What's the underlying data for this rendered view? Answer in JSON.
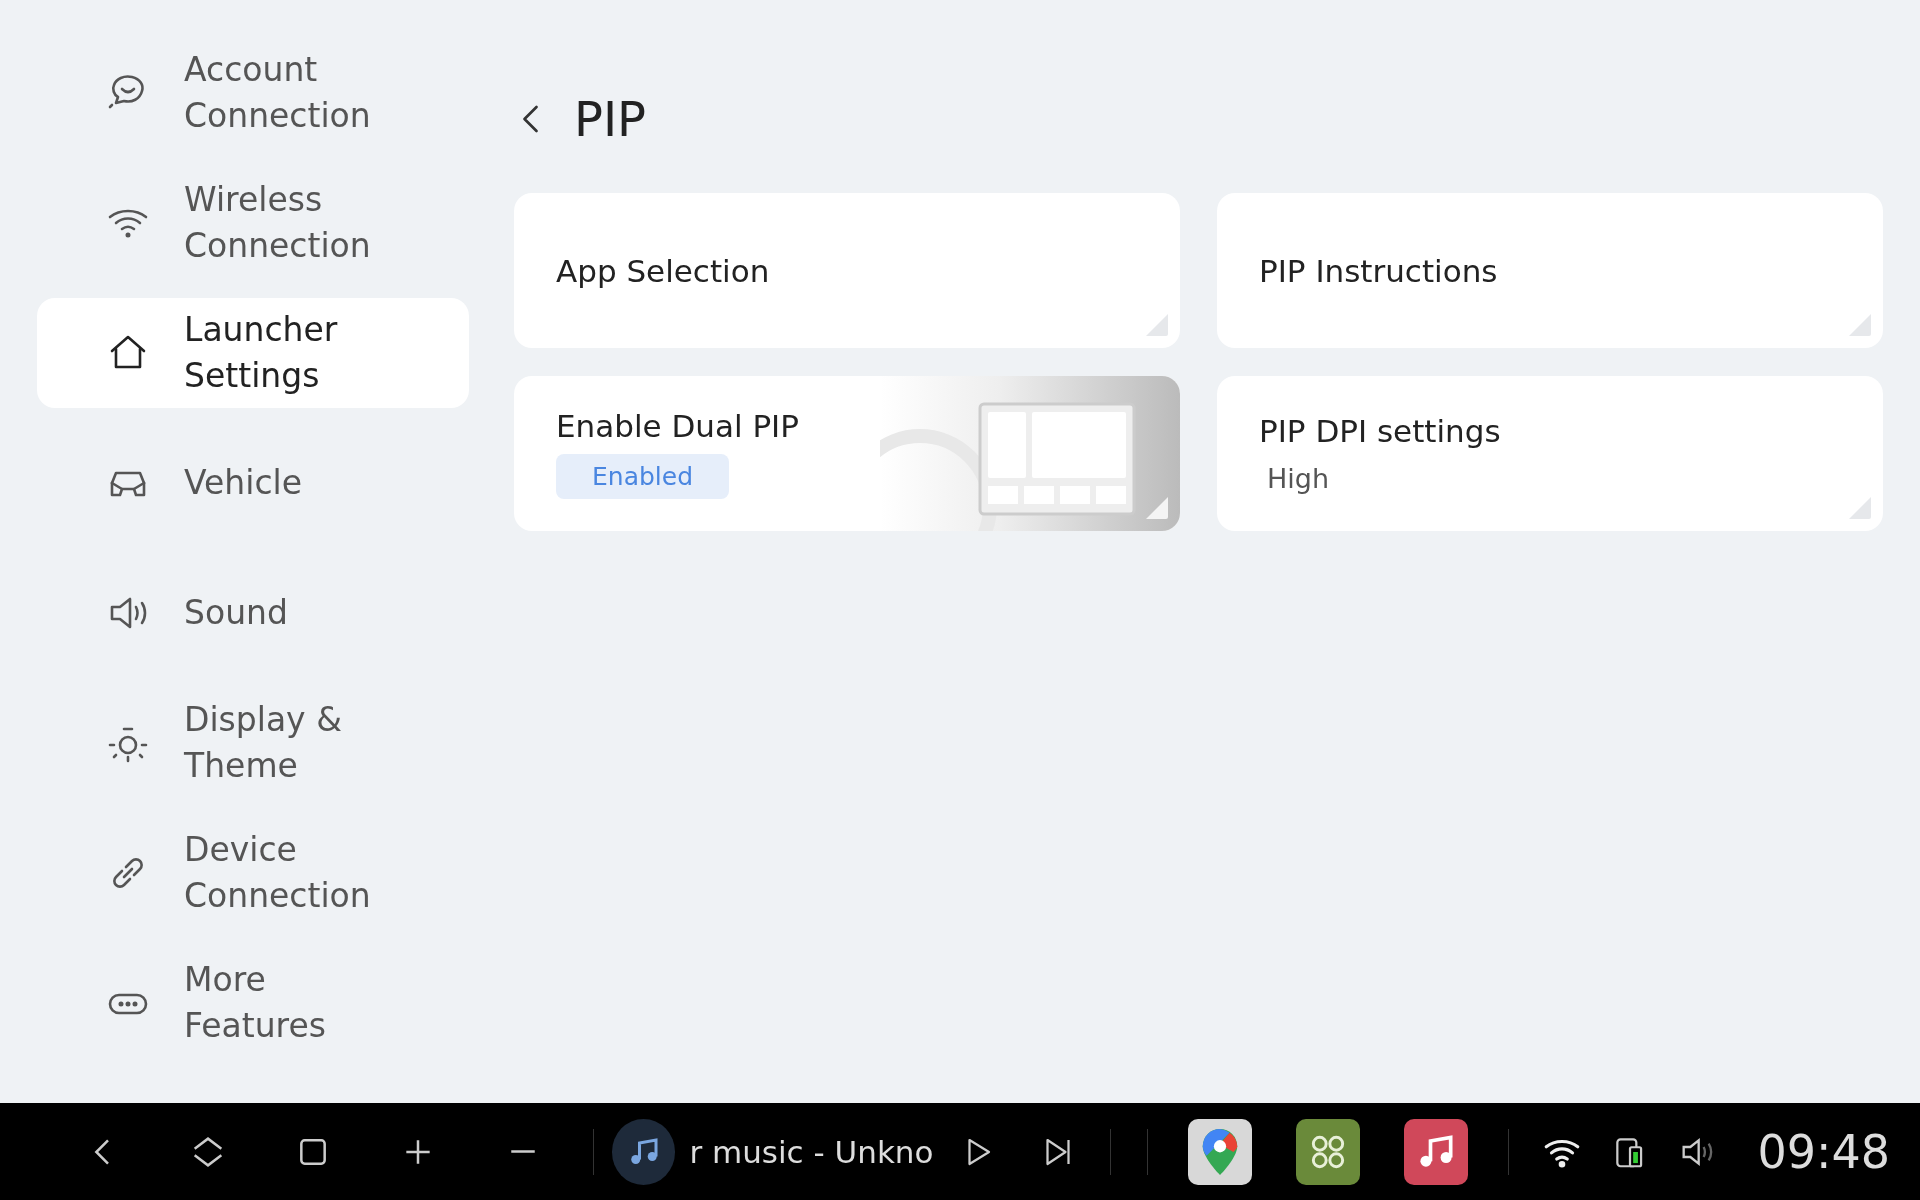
{
  "sidebar": {
    "items": [
      {
        "label": "Account Connection",
        "selected": false
      },
      {
        "label": "Wireless Connection",
        "selected": false
      },
      {
        "label": "Launcher Settings",
        "selected": true
      },
      {
        "label": "Vehicle",
        "selected": false
      },
      {
        "label": "Sound",
        "selected": false
      },
      {
        "label": "Display & Theme",
        "selected": false
      },
      {
        "label": "Device Connection",
        "selected": false
      },
      {
        "label": "More Features",
        "selected": false
      }
    ]
  },
  "page": {
    "title": "PIP"
  },
  "cards": [
    {
      "kind": "plain",
      "title": "App Selection"
    },
    {
      "kind": "plain",
      "title": "PIP Instructions"
    },
    {
      "kind": "toggle",
      "title": "Enable Dual PIP",
      "badge": "Enabled"
    },
    {
      "kind": "value",
      "title": "PIP DPI settings",
      "value": "High"
    }
  ],
  "taskbar": {
    "media_title": "r music - Unkno",
    "clock": "09:48"
  }
}
